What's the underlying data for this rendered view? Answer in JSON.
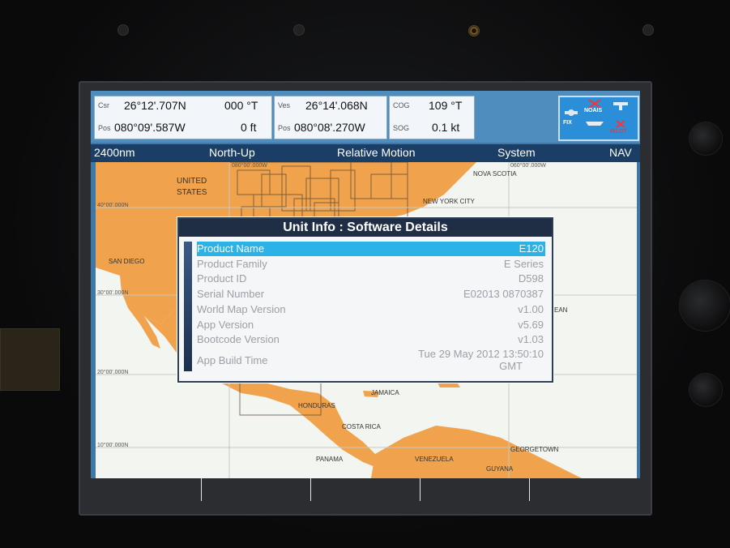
{
  "databar": {
    "csr_label": "Csr",
    "csr_lat": "26°12'.707N",
    "csr_bearing": "000 °T",
    "pos_label_1": "Pos",
    "csr_lon": "080°09'.587W",
    "csr_range": "0 ft",
    "ves_label": "Ves",
    "ves_lat": "26°14'.068N",
    "pos_label_2": "Pos",
    "ves_lon": "080°08'.270W",
    "cog_label": "COG",
    "cog_value": "109 °T",
    "sog_label": "SOG",
    "sog_value": "0.1 kt",
    "status": {
      "fix": "FIX",
      "noais": "NOAIS",
      "pilot": "PILOT"
    }
  },
  "header": {
    "range": "2400nm",
    "orientation": "North-Up",
    "motion": "Relative Motion",
    "system": "System",
    "nav": "NAV"
  },
  "map": {
    "labels": {
      "united": "UNITED",
      "states": "STATES",
      "nova_scotia": "NOVA SCOTIA",
      "new_york": "NEW YORK CITY",
      "san_diego": "SAN DIEGO",
      "ean": "EAN",
      "jamaica": "JAMAICA",
      "honduras": "HONDURAS",
      "costa_rica": "COSTA RICA",
      "panama": "PANAMA",
      "venezuela": "VENEZUELA",
      "georgetown": "GEORGETOWN",
      "guyana": "GUYANA"
    },
    "coords": {
      "lat40": "40°00'.000N",
      "lat30": "30°00'.000N",
      "lat20": "20°00'.000N",
      "lat10": "10°00'.000N",
      "lon80": "080°00'.000W",
      "lon60": "060°00'.000W"
    }
  },
  "dialog": {
    "title": "Unit Info : Software Details",
    "rows": [
      {
        "label": "Product Name",
        "value": "E120"
      },
      {
        "label": "Product Family",
        "value": "E Series"
      },
      {
        "label": "Product ID",
        "value": "D598"
      },
      {
        "label": "Serial Number",
        "value": "E02013 0870387"
      },
      {
        "label": "World Map Version",
        "value": "v1.00"
      },
      {
        "label": "App Version",
        "value": "v5.69"
      },
      {
        "label": "Bootcode Version",
        "value": "v1.03"
      },
      {
        "label": "App Build Time",
        "value": "Tue 29 May 2012 13:50:10",
        "value2": "GMT"
      }
    ]
  }
}
